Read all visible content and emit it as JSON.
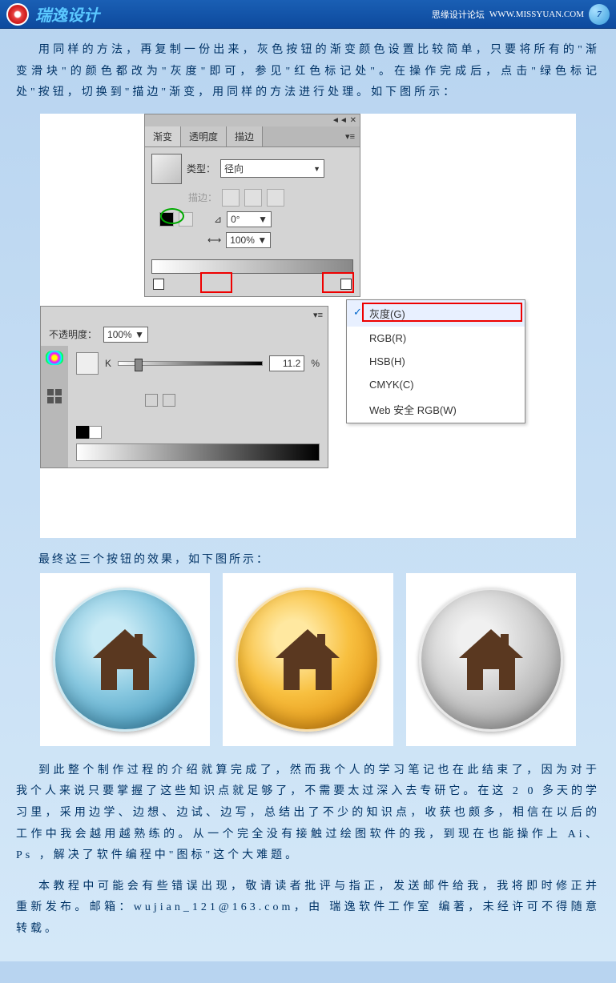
{
  "header": {
    "title": "瑞逸设计",
    "forum": "思缘设计论坛",
    "url": "WWW.MISSYUAN.COM",
    "badge": "7"
  },
  "paragraphs": {
    "p1": "用同样的方法，再复制一份出来，灰色按钮的渐变颜色设置比较简单，只要将所有的\"渐变滑块\"的颜色都改为\"灰度\"即可，参见\"红色标记处\"。在操作完成后，点击\"绿色标记处\"按钮，切换到\"描边\"渐变，用同样的方法进行处理。如下图所示：",
    "caption": "最终这三个按钮的效果，如下图所示：",
    "p2": "到此整个制作过程的介绍就算完成了，然而我个人的学习笔记也在此结束了，因为对于我个人来说只要掌握了这些知识点就足够了，不需要太过深入去专研它。在这 2 0 多天的学习里，采用边学、边想、边试、边写，总结出了不少的知识点，收获也颇多，相信在以后的工作中我会越用越熟练的。从一个完全没有接触过绘图软件的我，到现在也能操作上 Ai、Ps ，解决了软件编程中\"图标\"这个大难题。",
    "p3": "本教程中可能会有些错误出现，敬请读者批评与指正，发送邮件给我，我将即时修正并重新发布。邮箱：wujian_121@163.com，由 瑞逸软件工作室 编著，未经许可不得随意转载。"
  },
  "panel": {
    "collapse": "◄◄  ✕",
    "tabs": {
      "gradient": "渐变",
      "transparency": "透明度",
      "stroke": "描边"
    },
    "type_label": "类型：",
    "type_value": "径向",
    "stroke_label": "描边：",
    "angle_value": "0°",
    "scale_value": "100%",
    "menu_icon": "▾≡"
  },
  "color": {
    "opacity_label": "不透明度：",
    "opacity_value": "100%",
    "k_label": "K",
    "k_value": "11.2",
    "percent": "%",
    "menu_icon": "▾≡"
  },
  "menu": {
    "items": [
      "灰度(G)",
      "RGB(R)",
      "HSB(H)",
      "CMYK(C)",
      "Web 安全 RGB(W)"
    ]
  },
  "chart_data": {
    "type": "table",
    "note": "Illustrator Gradient/Color panel settings",
    "values": {
      "gradient_type": "径向",
      "gradient_angle_deg": 0,
      "gradient_scale_pct": 100,
      "opacity_pct": 100,
      "k_value_pct": 11.2,
      "color_mode_selected": "灰度(G)"
    }
  }
}
